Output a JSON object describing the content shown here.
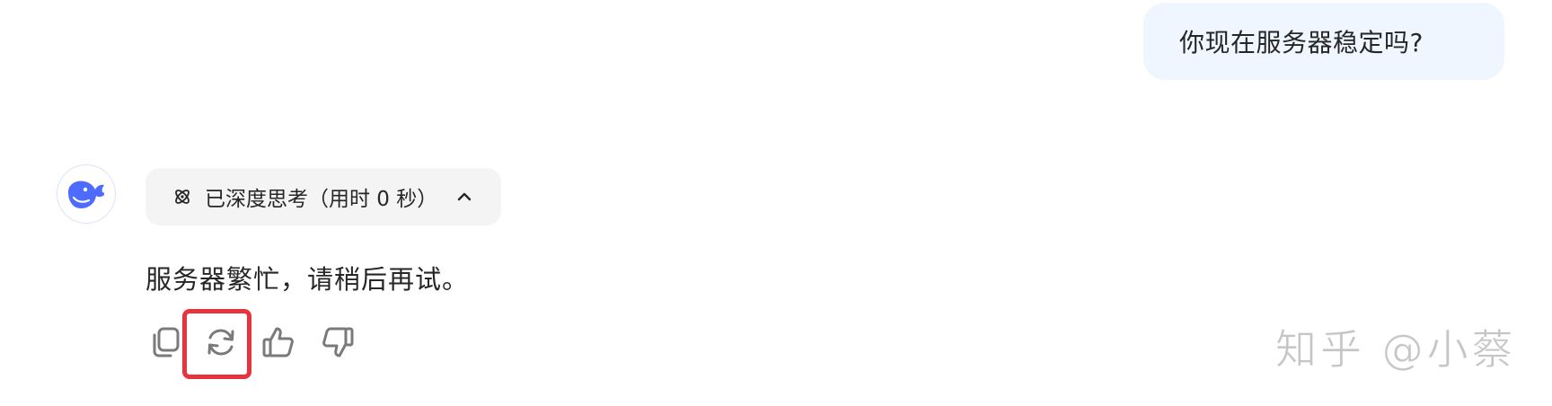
{
  "user_message": {
    "text": "你现在服务器稳定吗?"
  },
  "assistant": {
    "avatar_icon": "deepseek-whale-logo",
    "thinking": {
      "icon": "atom-icon",
      "label": "已深度思考（用时 0 秒）",
      "expand_icon": "chevron-up-icon"
    },
    "response_text": "服务器繁忙，请稍后再试。",
    "actions": [
      {
        "name": "copy",
        "icon": "copy-icon"
      },
      {
        "name": "regenerate",
        "icon": "refresh-icon",
        "highlighted": true
      },
      {
        "name": "like",
        "icon": "thumbs-up-icon"
      },
      {
        "name": "dislike",
        "icon": "thumbs-down-icon"
      }
    ]
  },
  "annotation": {
    "highlight_color": "#e8333c"
  },
  "watermark": {
    "text": "知乎 @小蔡"
  },
  "colors": {
    "user_bubble_bg": "#eff6ff",
    "brand_blue": "#4d6bfe",
    "pill_bg": "#f4f4f4",
    "icon_gray": "#7a7a7a"
  }
}
